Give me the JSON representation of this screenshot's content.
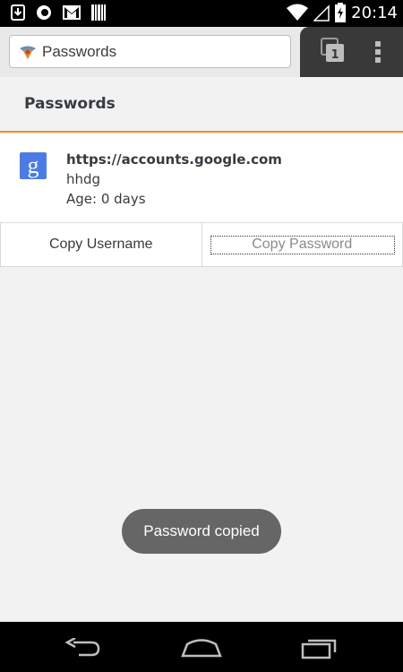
{
  "status_bar": {
    "time": "20:14",
    "icons": [
      "download-icon",
      "firefox-icon",
      "gmail-icon",
      "barcode-icon",
      "wifi-icon",
      "signal-icon",
      "battery-charging-icon"
    ]
  },
  "toolbar": {
    "url_text": "Passwords",
    "tab_count": "1"
  },
  "page": {
    "title": "Passwords"
  },
  "entry": {
    "site_icon_letter": "g",
    "url": "https://accounts.google.com",
    "username": "hhdg",
    "age": "Age: 0 days"
  },
  "actions": {
    "copy_username": "Copy Username",
    "copy_password": "Copy Password"
  },
  "toast": {
    "message": "Password copied"
  },
  "colors": {
    "accent": "#f08c2a",
    "toast_bg": "#666666",
    "google_icon": "#4b7be6"
  }
}
